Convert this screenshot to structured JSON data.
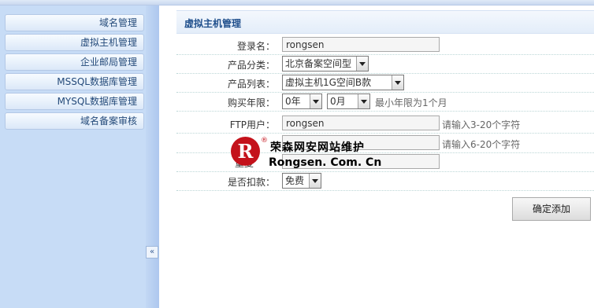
{
  "sidebar": {
    "items": [
      {
        "label": "域名管理"
      },
      {
        "label": "虚拟主机管理"
      },
      {
        "label": "企业邮局管理"
      },
      {
        "label": "MSSQL数据库管理"
      },
      {
        "label": "MYSQL数据库管理"
      },
      {
        "label": "域名备案审核"
      }
    ],
    "collapse_label": "«"
  },
  "panel": {
    "title": "虚拟主机管理"
  },
  "form": {
    "login": {
      "label": "登录名：",
      "value": "rongsen"
    },
    "category": {
      "label": "产品分类：",
      "value": "北京备案空间型"
    },
    "product": {
      "label": "产品列表：",
      "value": "虚拟主机1G空间B款"
    },
    "period": {
      "label": "购买年限：",
      "year_value": "0年",
      "month_value": "0月",
      "hint": "最小年限为1个月"
    },
    "ftp_user": {
      "label": "FTP用户：",
      "value": "rongsen",
      "hint": "请输入3-20个字符"
    },
    "ftp_pass": {
      "hint": "请输入6-20个字符"
    },
    "repeat_pass": {
      "label": "重复"
    },
    "deduct": {
      "label": "是否扣款：",
      "value": "免费"
    },
    "submit_label": "确定添加"
  },
  "watermark": {
    "logo_letter": "R",
    "reg_mark": "®",
    "line1": "荣森网安网站维护",
    "line2": "Rongsen. Com. Cn"
  },
  "colors": {
    "sidebar_bg": "#c7dcf6",
    "title_text": "#1f4f8c",
    "watermark_red": "#c4121b"
  }
}
